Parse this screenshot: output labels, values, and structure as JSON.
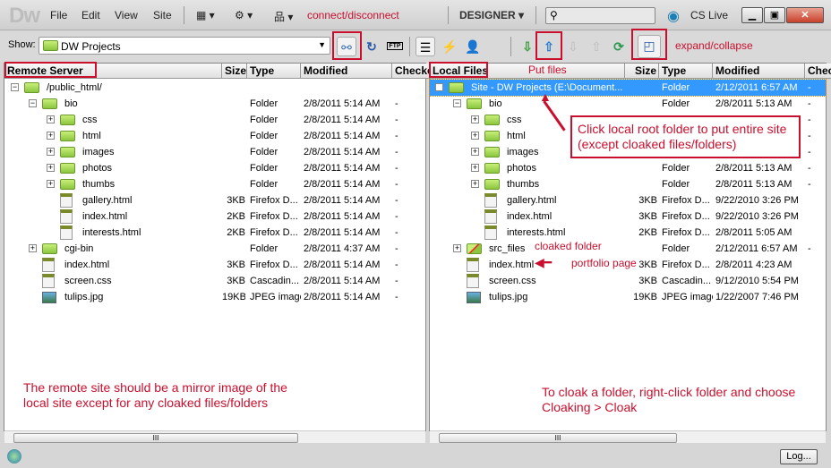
{
  "app": {
    "logo": "Dw",
    "menus": [
      "File",
      "Edit",
      "View",
      "Site"
    ],
    "workspace": "DESIGNER",
    "cs_live": "CS Live",
    "search_value": ""
  },
  "toolbar": {
    "show_label": "Show:",
    "site": "DW Projects",
    "icons": [
      "connect-icon",
      "refresh-icon",
      "ftp-log-icon",
      "site-files-icon",
      "testing-server-icon",
      "repository-icon",
      "get-icon",
      "put-icon",
      "check-out-icon",
      "check-in-icon",
      "synchronize-icon",
      "expand-collapse-icon"
    ],
    "ftp": "FTP"
  },
  "annotations": {
    "connect": "connect/disconnect",
    "expand": "expand/collapse",
    "put": "Put files",
    "callout": "Click local root folder to put entire site (except cloaked files/folders)",
    "cloaked": "cloaked folder",
    "portfolio": "portfolio page",
    "remote_note": "The remote site should be a mirror image of the local site except for any cloaked files/folders",
    "cloak_note": "To cloak a folder, right-click folder and choose Cloaking > Cloak",
    "color": "#c8102e"
  },
  "remote": {
    "headers": [
      "Remote Server",
      "Size",
      "Type",
      "Modified",
      "Checked Out"
    ],
    "rows": [
      {
        "level": 0,
        "toggle": "-",
        "icon": "folder",
        "name": "/public_html/",
        "size": "",
        "type": "",
        "modified": "",
        "check": ""
      },
      {
        "level": 1,
        "toggle": "-",
        "icon": "folder",
        "name": "bio",
        "size": "",
        "type": "Folder",
        "modified": "2/8/2011 5:14 AM",
        "check": "-"
      },
      {
        "level": 2,
        "toggle": "+",
        "icon": "folder",
        "name": "css",
        "size": "",
        "type": "Folder",
        "modified": "2/8/2011 5:14 AM",
        "check": "-"
      },
      {
        "level": 2,
        "toggle": "+",
        "icon": "folder",
        "name": "html",
        "size": "",
        "type": "Folder",
        "modified": "2/8/2011 5:14 AM",
        "check": "-"
      },
      {
        "level": 2,
        "toggle": "+",
        "icon": "folder",
        "name": "images",
        "size": "",
        "type": "Folder",
        "modified": "2/8/2011 5:14 AM",
        "check": "-"
      },
      {
        "level": 2,
        "toggle": "+",
        "icon": "folder",
        "name": "photos",
        "size": "",
        "type": "Folder",
        "modified": "2/8/2011 5:14 AM",
        "check": "-"
      },
      {
        "level": 2,
        "toggle": "+",
        "icon": "folder",
        "name": "thumbs",
        "size": "",
        "type": "Folder",
        "modified": "2/8/2011 5:14 AM",
        "check": "-"
      },
      {
        "level": 2,
        "toggle": "",
        "icon": "html",
        "name": "gallery.html",
        "size": "3KB",
        "type": "Firefox D...",
        "modified": "2/8/2011 5:14 AM",
        "check": "-"
      },
      {
        "level": 2,
        "toggle": "",
        "icon": "html",
        "name": "index.html",
        "size": "2KB",
        "type": "Firefox D...",
        "modified": "2/8/2011 5:14 AM",
        "check": "-"
      },
      {
        "level": 2,
        "toggle": "",
        "icon": "html",
        "name": "interests.html",
        "size": "2KB",
        "type": "Firefox D...",
        "modified": "2/8/2011 5:14 AM",
        "check": "-"
      },
      {
        "level": 1,
        "toggle": "+",
        "icon": "folder",
        "name": "cgi-bin",
        "size": "",
        "type": "Folder",
        "modified": "2/8/2011 4:37 AM",
        "check": "-"
      },
      {
        "level": 1,
        "toggle": "",
        "icon": "html",
        "name": "index.html",
        "size": "3KB",
        "type": "Firefox D...",
        "modified": "2/8/2011 5:14 AM",
        "check": "-"
      },
      {
        "level": 1,
        "toggle": "",
        "icon": "css",
        "name": "screen.css",
        "size": "3KB",
        "type": "Cascadin...",
        "modified": "2/8/2011 5:14 AM",
        "check": "-"
      },
      {
        "level": 1,
        "toggle": "",
        "icon": "image",
        "name": "tulips.jpg",
        "size": "19KB",
        "type": "JPEG image",
        "modified": "2/8/2011 5:14 AM",
        "check": "-"
      }
    ]
  },
  "local": {
    "headers": [
      "Local Files",
      "Size",
      "Type",
      "Modified",
      "Checked Out"
    ],
    "rows": [
      {
        "level": 0,
        "toggle": "-",
        "icon": "folder",
        "name": "Site - DW Projects (E:\\Document...",
        "size": "",
        "type": "Folder",
        "modified": "2/12/2011 6:57 AM",
        "check": "-",
        "selected": true
      },
      {
        "level": 1,
        "toggle": "-",
        "icon": "folder",
        "name": "bio",
        "size": "",
        "type": "Folder",
        "modified": "2/8/2011 5:13 AM",
        "check": "-"
      },
      {
        "level": 2,
        "toggle": "+",
        "icon": "folder",
        "name": "css",
        "size": "",
        "type": "",
        "modified": "",
        "check": "-"
      },
      {
        "level": 2,
        "toggle": "+",
        "icon": "folder",
        "name": "html",
        "size": "",
        "type": "",
        "modified": "",
        "check": "-"
      },
      {
        "level": 2,
        "toggle": "+",
        "icon": "folder",
        "name": "images",
        "size": "",
        "type": "",
        "modified": "",
        "check": "-"
      },
      {
        "level": 2,
        "toggle": "+",
        "icon": "folder",
        "name": "photos",
        "size": "",
        "type": "Folder",
        "modified": "2/8/2011 5:13 AM",
        "check": "-"
      },
      {
        "level": 2,
        "toggle": "+",
        "icon": "folder",
        "name": "thumbs",
        "size": "",
        "type": "Folder",
        "modified": "2/8/2011 5:13 AM",
        "check": "-"
      },
      {
        "level": 2,
        "toggle": "",
        "icon": "html",
        "name": "gallery.html",
        "size": "3KB",
        "type": "Firefox D...",
        "modified": "9/22/2010 3:26 PM",
        "check": ""
      },
      {
        "level": 2,
        "toggle": "",
        "icon": "html",
        "name": "index.html",
        "size": "3KB",
        "type": "Firefox D...",
        "modified": "9/22/2010 3:26 PM",
        "check": ""
      },
      {
        "level": 2,
        "toggle": "",
        "icon": "html",
        "name": "interests.html",
        "size": "2KB",
        "type": "Firefox D...",
        "modified": "2/8/2011 5:05 AM",
        "check": ""
      },
      {
        "level": 1,
        "toggle": "+",
        "icon": "cloaked-folder",
        "name": "src_files",
        "size": "",
        "type": "Folder",
        "modified": "2/12/2011 6:57 AM",
        "check": "-"
      },
      {
        "level": 1,
        "toggle": "",
        "icon": "html",
        "name": "index.html",
        "size": "3KB",
        "type": "Firefox D...",
        "modified": "2/8/2011 4:23 AM",
        "check": ""
      },
      {
        "level": 1,
        "toggle": "",
        "icon": "css",
        "name": "screen.css",
        "size": "3KB",
        "type": "Cascadin...",
        "modified": "9/12/2010 5:54 PM",
        "check": ""
      },
      {
        "level": 1,
        "toggle": "",
        "icon": "image",
        "name": "tulips.jpg",
        "size": "19KB",
        "type": "JPEG image",
        "modified": "1/22/2007 7:46 PM",
        "check": ""
      }
    ]
  },
  "status": {
    "log_button": "Log...",
    "scroll_grip": "III"
  }
}
